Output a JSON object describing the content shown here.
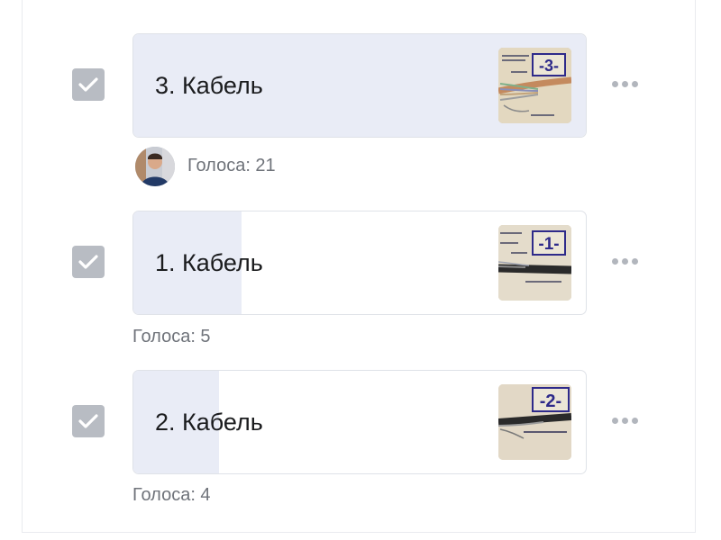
{
  "options": [
    {
      "label": "3. Кабель",
      "votes_text": "Голоса: 21",
      "votes": 21,
      "share": 1.0,
      "checked": true,
      "thumb_number": "-3-"
    },
    {
      "label": "1. Кабель",
      "votes_text": "Голоса: 5",
      "votes": 5,
      "share": 0.24,
      "checked": true,
      "thumb_number": "-1-"
    },
    {
      "label": "2. Кабель",
      "votes_text": "Голоса: 4",
      "votes": 4,
      "share": 0.19,
      "checked": true,
      "thumb_number": "-2-"
    }
  ],
  "icons": {
    "checkbox": "check-icon",
    "more": "more-dots-icon",
    "avatar": "voter-avatar"
  },
  "colors": {
    "bar_fill": "#e9ecf6",
    "checkbox": "#b8bcc3",
    "thumb_number": "#2e2a8a"
  }
}
